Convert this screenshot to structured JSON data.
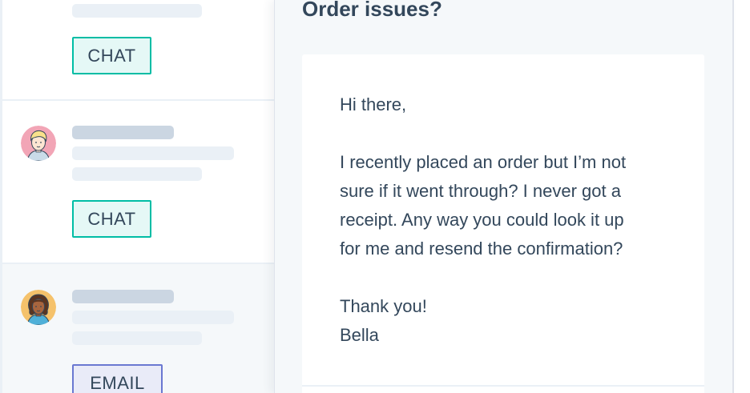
{
  "inbox": {
    "conversations": [
      {
        "channel": "CHAT",
        "avatar": "partial-avatar-hidden"
      },
      {
        "channel": "CHAT",
        "avatar": "blond-man-avatar-icon"
      },
      {
        "channel": "EMAIL",
        "avatar": "curly-hair-woman-avatar-icon"
      }
    ]
  },
  "detail": {
    "title": "Order issues?",
    "message": {
      "greeting": "Hi there,",
      "body_lines": [
        "I recently placed an order but I’m not",
        "sure if it went through? I never got a",
        "receipt. Any way you could look it up",
        "for me and resend the confirmation?"
      ],
      "closing": "Thank you!",
      "signature": "Bella"
    }
  },
  "colors": {
    "chat_tag_bg": "#e5f8f6",
    "chat_tag_border": "#00bda5",
    "email_tag_bg": "#e9ebf8",
    "email_tag_border": "#6a78d1",
    "text": "#33475b",
    "skeleton_dark": "#cbd6e2",
    "skeleton_light": "#eaf0f6"
  }
}
